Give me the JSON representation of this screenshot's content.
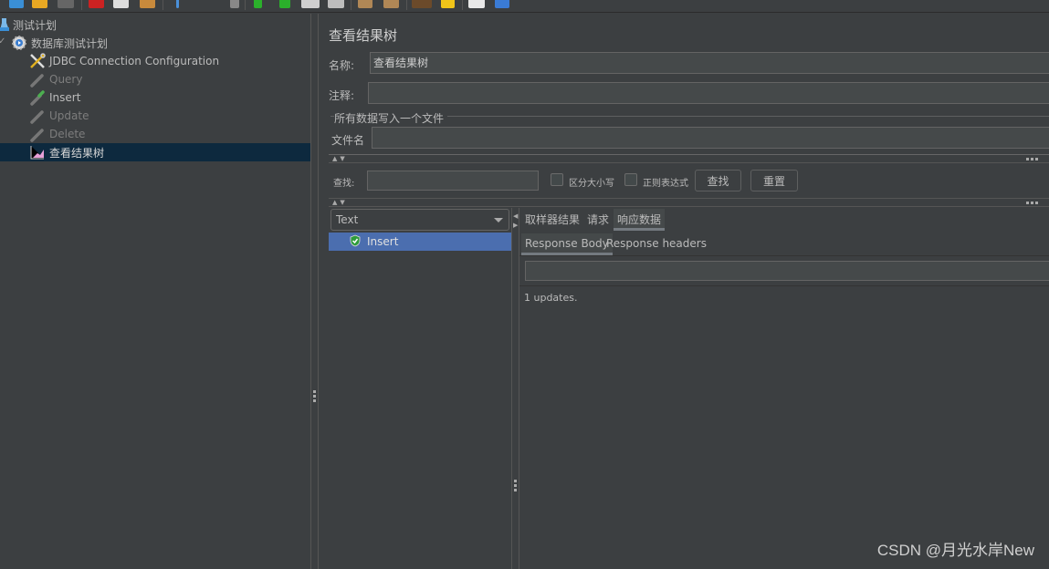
{
  "toolbar": {
    "icons": [
      "templates-icon",
      "open-icon",
      "save-icon",
      "cut-icon",
      "copy-icon",
      "paste-icon",
      "expand-icon",
      "toggle-icon",
      "start-icon",
      "start-no-pause-icon",
      "stop-icon",
      "shutdown-icon",
      "clear-icon",
      "clear-all-icon",
      "search-icon",
      "reset-search-icon",
      "function-helper-icon",
      "help-icon"
    ]
  },
  "tree": {
    "items": [
      {
        "label": "测试计划",
        "icon": "test-plan-icon",
        "state": "normal"
      },
      {
        "label": "数据库测试计划",
        "icon": "thread-group-icon",
        "state": "normal"
      },
      {
        "label": "JDBC Connection Configuration",
        "icon": "config-element-icon",
        "state": "normal"
      },
      {
        "label": "Query",
        "icon": "sampler-icon",
        "state": "disabled"
      },
      {
        "label": "Insert",
        "icon": "sampler-icon",
        "state": "enabled"
      },
      {
        "label": "Update",
        "icon": "sampler-icon",
        "state": "disabled"
      },
      {
        "label": "Delete",
        "icon": "sampler-icon",
        "state": "disabled"
      },
      {
        "label": "查看结果树",
        "icon": "listener-icon",
        "state": "selected"
      }
    ]
  },
  "panel": {
    "title": "查看结果树",
    "name_label": "名称:",
    "name_value": "查看结果树",
    "comment_label": "注释:",
    "comment_value": "",
    "file_group_label": "所有数据写入一个文件",
    "filename_label": "文件名",
    "filename_value": ""
  },
  "search": {
    "label": "查找:",
    "value": "",
    "case_sensitive_label": "区分大小写",
    "case_sensitive_checked": false,
    "regex_label": "正则表达式",
    "regex_checked": false,
    "find_button": "查找",
    "reset_button": "重置"
  },
  "results": {
    "renderer_selected": "Text",
    "items": [
      {
        "label": "Insert",
        "status": "success"
      }
    ],
    "tabs": [
      "取样器结果",
      "请求",
      "响应数据"
    ],
    "active_tab": "响应数据",
    "subtabs": [
      "Response Body",
      "Response headers"
    ],
    "active_subtab": "Response Body",
    "response_search_value": "",
    "response_body": "1 updates."
  },
  "watermark": "CSDN @月光水岸New"
}
